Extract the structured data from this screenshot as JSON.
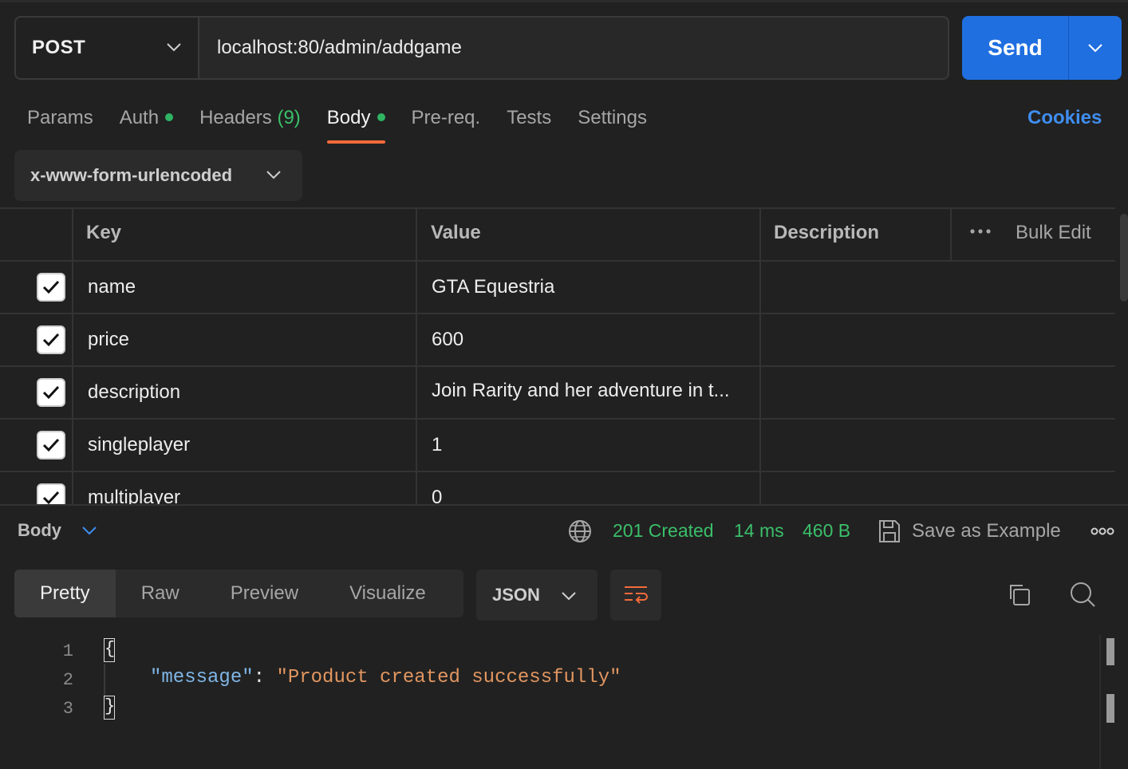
{
  "request": {
    "method": "POST",
    "url": "localhost:80/admin/addgame",
    "send_label": "Send"
  },
  "tabs": {
    "params": "Params",
    "auth": "Auth",
    "headers": "Headers",
    "headers_count": "(9)",
    "body": "Body",
    "prereq": "Pre-req.",
    "tests": "Tests",
    "settings": "Settings",
    "cookies": "Cookies"
  },
  "body_type": "x-www-form-urlencoded",
  "table": {
    "headers": {
      "key": "Key",
      "value": "Value",
      "description": "Description",
      "bulk_edit": "Bulk Edit"
    },
    "rows": [
      {
        "key": "name",
        "value": "GTA Equestria",
        "checked": true
      },
      {
        "key": "price",
        "value": "600",
        "checked": true
      },
      {
        "key": "description",
        "value": "Join Rarity and her adventure in t...",
        "checked": true
      },
      {
        "key": "singleplayer",
        "value": "1",
        "checked": true
      },
      {
        "key": "multiplayer",
        "value": "0",
        "checked": true
      }
    ]
  },
  "response": {
    "body_label": "Body",
    "status": "201 Created",
    "time": "14 ms",
    "size": "460 B",
    "save_label": "Save as Example",
    "view_tabs": [
      "Pretty",
      "Raw",
      "Preview",
      "Visualize"
    ],
    "format": "JSON",
    "code": {
      "line_numbers": [
        "1",
        "2",
        "3"
      ],
      "open_brace": "{",
      "close_brace": "}",
      "key": "\"message\"",
      "colon": ": ",
      "value": "\"Product created successfully\""
    }
  },
  "colors": {
    "accent_blue": "#1f6fe0",
    "tab_underline": "#f26b3a",
    "status_green": "#3bbf6a",
    "json_key": "#7fb6e6",
    "json_string": "#e29660"
  },
  "icons": [
    "chevron-down-icon",
    "checkmark-icon",
    "more-icon",
    "globe-icon",
    "save-icon",
    "wrap-icon",
    "copy-icon",
    "search-icon"
  ]
}
